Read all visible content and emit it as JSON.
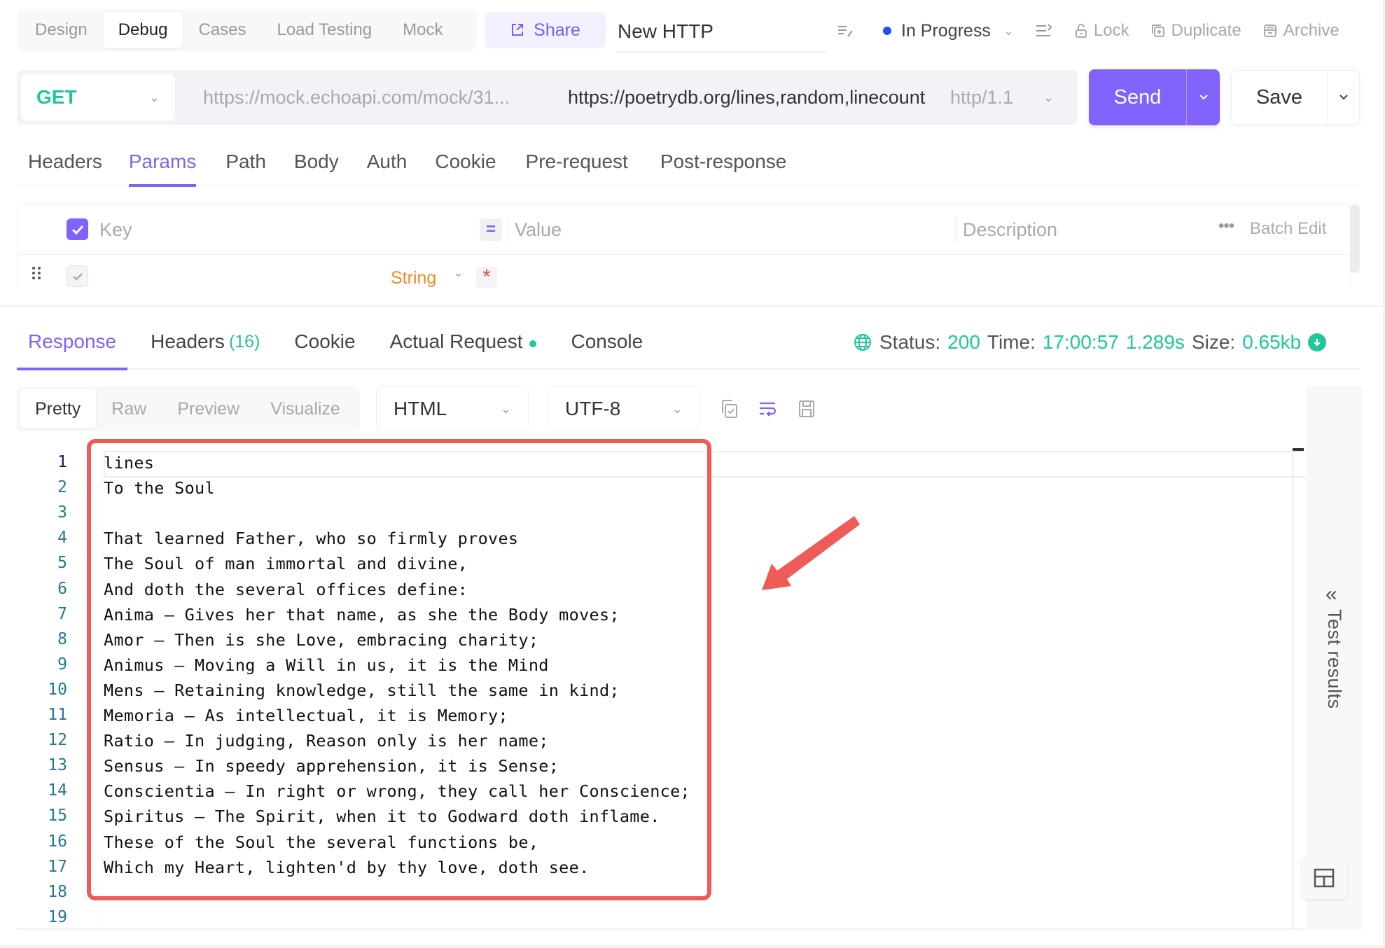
{
  "top_bar": {
    "mode_tabs": [
      "Design",
      "Debug",
      "Cases",
      "Load Testing",
      "Mock"
    ],
    "active_mode": "Debug",
    "share_label": "Share",
    "request_name": "New HTTP",
    "status_dropdown": "In Progress",
    "status_color": "#1d4ff5",
    "lock_label": "Lock",
    "duplicate_label": "Duplicate",
    "archive_label": "Archive"
  },
  "url_bar": {
    "method": "GET",
    "mock_url": "https://mock.echoapi.com/mock/31...",
    "url": "https://poetrydb.org/lines,random,linecount",
    "http_version": "http/1.1",
    "send_label": "Send",
    "save_label": "Save"
  },
  "request_tabs": [
    "Headers",
    "Params",
    "Path",
    "Body",
    "Auth",
    "Cookie",
    "Pre-request",
    "Post-response"
  ],
  "active_request_tab": "Params",
  "params_table": {
    "headers": {
      "key": "Key",
      "value": "Value",
      "description": "Description"
    },
    "batch_edit_label": "Batch Edit",
    "rows": [
      {
        "key": "",
        "type": "String",
        "required": "*",
        "value": "",
        "description": ""
      }
    ]
  },
  "response": {
    "tabs": [
      {
        "label": "Response"
      },
      {
        "label": "Headers",
        "count": "(16)"
      },
      {
        "label": "Cookie"
      },
      {
        "label": "Actual Request"
      },
      {
        "label": "Console"
      }
    ],
    "active_tab": "Response",
    "status_label": "Status:",
    "status_value": "200",
    "time_label": "Time:",
    "time_value": "17:00:57",
    "duration": "1.289s",
    "size_label": "Size:",
    "size_value": "0.65kb",
    "view_tabs": [
      "Pretty",
      "Raw",
      "Preview",
      "Visualize"
    ],
    "active_view": "Pretty",
    "format": "HTML",
    "encoding": "UTF-8",
    "lines": [
      "lines",
      "To the Soul",
      "",
      "That learned Father, who so firmly proves",
      "The Soul of man immortal and divine,",
      "And doth the several offices define:",
      "Anima – Gives her that name, as she the Body moves;",
      "Amor – Then is she Love, embracing charity;",
      "Animus – Moving a Will in us, it is the Mind",
      "Mens – Retaining knowledge, still the same in kind;",
      "Memoria – As intellectual, it is Memory;",
      "Ratio – In judging, Reason only is her name;",
      "Sensus – In speedy apprehension, it is Sense;",
      "Conscientia – In right or wrong, they call her Conscience;",
      "Spiritus – The Spirit, when it to Godward doth inflame.",
      "These of the Soul the several functions be,",
      "Which my Heart, lighten'd by thy love, doth see.",
      "",
      ""
    ]
  },
  "side_panel": {
    "label": "Test results"
  },
  "colors": {
    "accent": "#8162fb",
    "success": "#1fc79a",
    "annotation": "#ef5b56",
    "type_string": "#f5891f"
  }
}
